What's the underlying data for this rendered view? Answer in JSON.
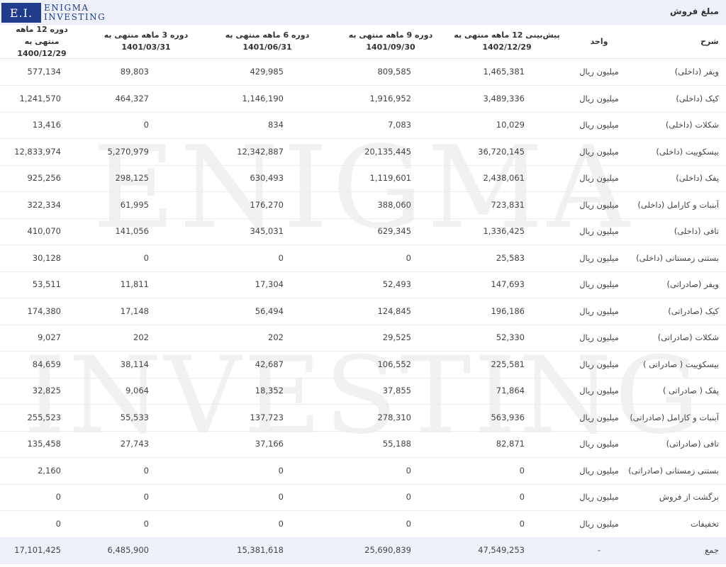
{
  "header": {
    "title": "مبلغ فروش"
  },
  "logo": {
    "abbr": "E.I.",
    "line1": "ENIGMA",
    "line2": "INVESTING",
    "brand_color": "#1f3c8c"
  },
  "watermark": {
    "line1": "ENIGMA",
    "line2": "INVESTING"
  },
  "columns": {
    "desc": "شرح",
    "unit": "واحد",
    "v0": "پیش‌بینی 12 ماهه منتهی به 1402/12/29",
    "v1": "دوره 9 ماهه منتهی به 1401/09/30",
    "v2": "دوره 6 ماهه منتهی به 1401/06/31",
    "v3": "دوره 3 ماهه منتهی به 1401/03/31",
    "v4": "دوره 12 ماهه منتهی به 1400/12/29"
  },
  "rows": [
    {
      "desc": "ویفر (داخلی)",
      "unit": "میلیون ریال",
      "v0": "1,465,381",
      "v1": "809,585",
      "v2": "429,985",
      "v3": "89,803",
      "v4": "577,134"
    },
    {
      "desc": "کیک (داخلی)",
      "unit": "میلیون ریال",
      "v0": "3,489,336",
      "v1": "1,916,952",
      "v2": "1,146,190",
      "v3": "464,327",
      "v4": "1,241,570"
    },
    {
      "desc": "شکلات (داخلی)",
      "unit": "میلیون ریال",
      "v0": "10,029",
      "v1": "7,083",
      "v2": "834",
      "v3": "0",
      "v4": "13,416"
    },
    {
      "desc": "بیسکوییت (داخلی)",
      "unit": "میلیون ریال",
      "v0": "36,720,145",
      "v1": "20,135,445",
      "v2": "12,342,887",
      "v3": "5,270,979",
      "v4": "12,833,974"
    },
    {
      "desc": "پفک (داخلی)",
      "unit": "میلیون ریال",
      "v0": "2,438,061",
      "v1": "1,119,601",
      "v2": "630,493",
      "v3": "298,125",
      "v4": "925,256"
    },
    {
      "desc": "آبنبات و کارامل (داخلی)",
      "unit": "میلیون ریال",
      "v0": "723,831",
      "v1": "388,060",
      "v2": "176,270",
      "v3": "61,995",
      "v4": "322,334"
    },
    {
      "desc": "تافی (داخلی)",
      "unit": "میلیون ریال",
      "v0": "1,336,425",
      "v1": "629,345",
      "v2": "345,031",
      "v3": "141,056",
      "v4": "410,070"
    },
    {
      "desc": "بستنی زمستانی (داخلی)",
      "unit": "میلیون ریال",
      "v0": "25,583",
      "v1": "0",
      "v2": "0",
      "v3": "0",
      "v4": "30,128"
    },
    {
      "desc": "ویفر (صادراتی)",
      "unit": "میلیون ریال",
      "v0": "147,693",
      "v1": "52,493",
      "v2": "17,304",
      "v3": "11,811",
      "v4": "53,511"
    },
    {
      "desc": "کیک (صادراتی)",
      "unit": "میلیون ریال",
      "v0": "196,186",
      "v1": "124,845",
      "v2": "56,494",
      "v3": "17,148",
      "v4": "174,380"
    },
    {
      "desc": "شکلات (صادراتی)",
      "unit": "میلیون ریال",
      "v0": "52,330",
      "v1": "29,525",
      "v2": "202",
      "v3": "202",
      "v4": "9,027"
    },
    {
      "desc": "بیسکوییت ( صادراتی )",
      "unit": "میلیون ریال",
      "v0": "225,581",
      "v1": "106,552",
      "v2": "42,687",
      "v3": "38,114",
      "v4": "84,659"
    },
    {
      "desc": "پفک ( صادراتی )",
      "unit": "میلیون ریال",
      "v0": "71,864",
      "v1": "37,855",
      "v2": "18,352",
      "v3": "9,064",
      "v4": "32,825"
    },
    {
      "desc": "آبنبات و کارامل (صادراتی)",
      "unit": "میلیون ریال",
      "v0": "563,936",
      "v1": "278,310",
      "v2": "137,723",
      "v3": "55,533",
      "v4": "255,523"
    },
    {
      "desc": "تافی (صادراتی)",
      "unit": "میلیون ریال",
      "v0": "82,871",
      "v1": "55,188",
      "v2": "37,166",
      "v3": "27,743",
      "v4": "135,458"
    },
    {
      "desc": "بستنی زمستانی (صادراتی)",
      "unit": "میلیون ریال",
      "v0": "0",
      "v1": "0",
      "v2": "0",
      "v3": "0",
      "v4": "2,160"
    },
    {
      "desc": "برگشت از فروش",
      "unit": "میلیون ریال",
      "v0": "0",
      "v1": "0",
      "v2": "0",
      "v3": "0",
      "v4": "0"
    },
    {
      "desc": "تخفیفات",
      "unit": "میلیون ریال",
      "v0": "0",
      "v1": "0",
      "v2": "0",
      "v3": "0",
      "v4": "0"
    },
    {
      "desc": "جمع",
      "unit": "-",
      "v0": "47,549,253",
      "v1": "25,690,839",
      "v2": "15,381,618",
      "v3": "6,485,900",
      "v4": "17,101,425",
      "total": true
    }
  ]
}
